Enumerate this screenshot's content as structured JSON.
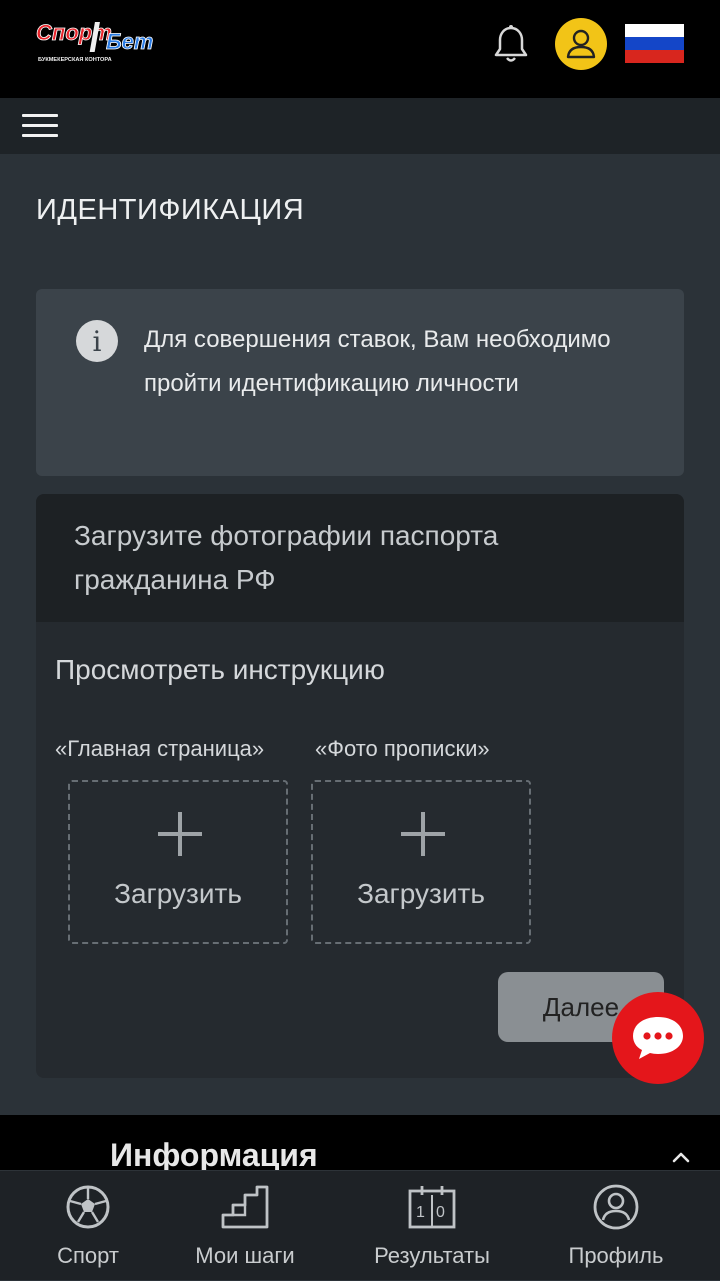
{
  "header": {
    "logo_main": "СпортБет",
    "logo_tagline": "БУКМЕКЕРСКАЯ КОНТОРА",
    "icons": [
      "bell-icon",
      "user-icon",
      "russia-flag-icon"
    ],
    "flag_colors": [
      "#ffffff",
      "#1446c8",
      "#d8261e"
    ],
    "avatar_color": "#f2c417"
  },
  "page": {
    "title": "ИДЕНТИФИКАЦИЯ"
  },
  "info": {
    "icon": "info-icon",
    "text": "Для совершения ставок, Вам необходимо пройти идентификацию личности"
  },
  "upload": {
    "heading": "Загрузите фотографии паспорта гражданина РФ",
    "instruction_link": "Просмотреть инструкцию",
    "slots": [
      {
        "label": "«Главная страница»",
        "button": "Загрузить"
      },
      {
        "label": "«Фото прописки»",
        "button": "Загрузить"
      }
    ],
    "next_button": "Далее"
  },
  "chat": {
    "icon": "chat-bubble-icon",
    "color": "#e4161b"
  },
  "footer": {
    "info_title": "Информация"
  },
  "bottom_nav": {
    "items": [
      {
        "label": "Спорт",
        "icon": "soccer-ball-icon"
      },
      {
        "label": "Мои шаги",
        "icon": "steps-icon"
      },
      {
        "label": "Результаты",
        "icon": "scoreboard-icon"
      },
      {
        "label": "Профиль",
        "icon": "profile-icon"
      }
    ]
  }
}
